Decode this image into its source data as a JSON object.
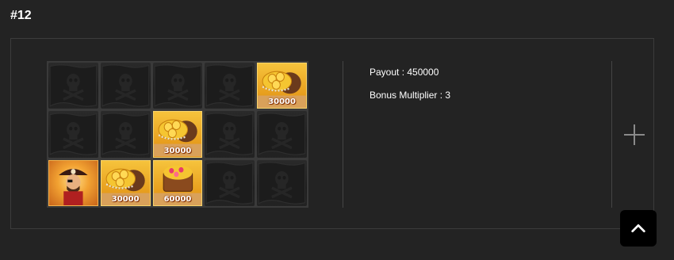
{
  "round": {
    "title": "#12"
  },
  "grid": {
    "rows": [
      [
        {
          "symbol": "skull-flag"
        },
        {
          "symbol": "skull-flag"
        },
        {
          "symbol": "skull-flag"
        },
        {
          "symbol": "skull-flag"
        },
        {
          "symbol": "treasure-coins",
          "value": "30000"
        }
      ],
      [
        {
          "symbol": "skull-flag"
        },
        {
          "symbol": "skull-flag"
        },
        {
          "symbol": "treasure-coins",
          "value": "30000"
        },
        {
          "symbol": "skull-flag"
        },
        {
          "symbol": "skull-flag"
        }
      ],
      [
        {
          "symbol": "pirate-captain"
        },
        {
          "symbol": "treasure-coins",
          "value": "30000"
        },
        {
          "symbol": "treasure-chest-gems",
          "value": "60000"
        },
        {
          "symbol": "skull-flag"
        },
        {
          "symbol": "skull-flag"
        }
      ]
    ]
  },
  "info": {
    "payout": "Payout : 450000",
    "bonus_multiplier": "Bonus Multiplier : 3"
  },
  "controls": {
    "expand_icon": "plus-icon",
    "scroll_top_icon": "chevron-up-icon"
  },
  "colors": {
    "background": "#232323",
    "panel_border": "#3c3c3c",
    "gold": "#f6c33c"
  }
}
